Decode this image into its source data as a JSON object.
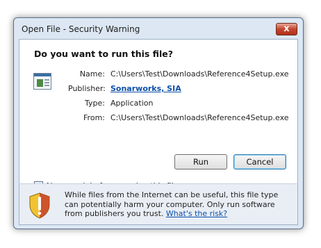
{
  "window": {
    "title": "Open File - Security Warning",
    "close_glyph": "x"
  },
  "content": {
    "heading": "Do you want to run this file?",
    "file_icon": "application-icon",
    "properties": [
      {
        "label": "Name:",
        "value": "C:\\Users\\Test\\Downloads\\Reference4Setup.exe"
      },
      {
        "label": "Publisher:",
        "value": "Sonarworks, SIA"
      },
      {
        "label": "Type:",
        "value": "Application"
      },
      {
        "label": "From:",
        "value": "C:\\Users\\Test\\Downloads\\Reference4Setup.exe"
      }
    ],
    "run_label": "Run",
    "cancel_label": "Cancel",
    "checkbox": {
      "checked": true,
      "check_glyph": "✓",
      "label": "Always ask before opening this file"
    }
  },
  "footer": {
    "icon": "warning-shield-icon",
    "text": "While files from the Internet can be useful, this file type can potentially harm your computer. Only run software from publishers you trust.",
    "link": "What's the risk?"
  },
  "colors": {
    "frame": "#dce7f3",
    "link": "#0b4fa8",
    "close": "#c4452d",
    "shield_yellow": "#f1c232",
    "shield_red": "#c8412b"
  }
}
